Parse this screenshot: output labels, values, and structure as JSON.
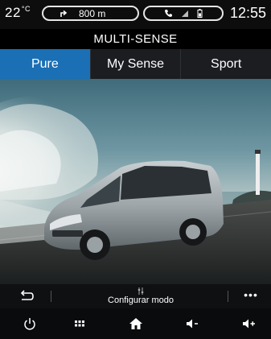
{
  "status": {
    "temperature": "22",
    "temp_unit": "°C",
    "nav_distance": "800 m",
    "time": "12:55"
  },
  "header": {
    "title": "MULTI-SENSE"
  },
  "tabs": [
    {
      "label": "Pure",
      "active": true
    },
    {
      "label": "My Sense",
      "active": false
    },
    {
      "label": "Sport",
      "active": false
    }
  ],
  "toolbar": {
    "back_icon": "back-arrow-icon",
    "config_label": "Configurar modo",
    "config_icon": "settings-sliders-icon",
    "more_label": "•••"
  },
  "bottom_nav": [
    "power-icon",
    "apps-grid-icon",
    "home-icon",
    "volume-down-icon",
    "volume-up-icon"
  ],
  "colors": {
    "accent": "#1a6fb5",
    "background": "#000000",
    "tab_bar": "#1b1d21"
  }
}
